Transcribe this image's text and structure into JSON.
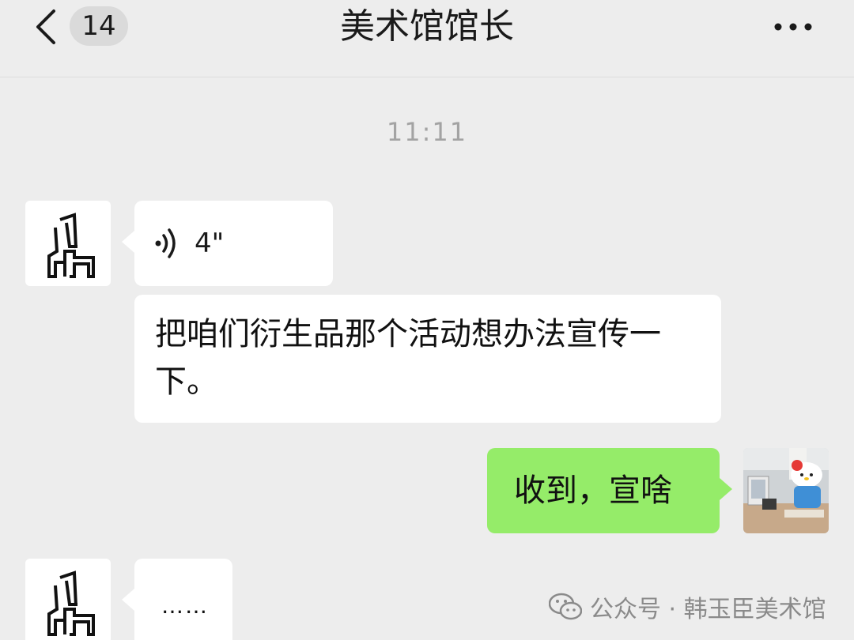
{
  "header": {
    "back_icon": "chevron-left-icon",
    "unread_count": "14",
    "title": "美术馆馆长",
    "more_icon": "more-dots-icon"
  },
  "chat": {
    "timestamp": "11:11",
    "messages": [
      {
        "sender": "other",
        "type": "voice",
        "duration": "4\"",
        "icon": "voice-wave-icon"
      },
      {
        "sender": "other",
        "type": "text",
        "text": "把咱们衍生品那个活动想办法宣传一下。"
      },
      {
        "sender": "me",
        "type": "text",
        "text": "收到，宣啥"
      },
      {
        "sender": "other",
        "type": "text",
        "text": "……"
      }
    ]
  },
  "watermark": {
    "icon": "wechat-icon",
    "text": "公众号 · 韩玉臣美术馆"
  },
  "colors": {
    "background": "#ededed",
    "bubble_other": "#ffffff",
    "bubble_me": "#95ec69",
    "timestamp": "#a3a3a3"
  }
}
